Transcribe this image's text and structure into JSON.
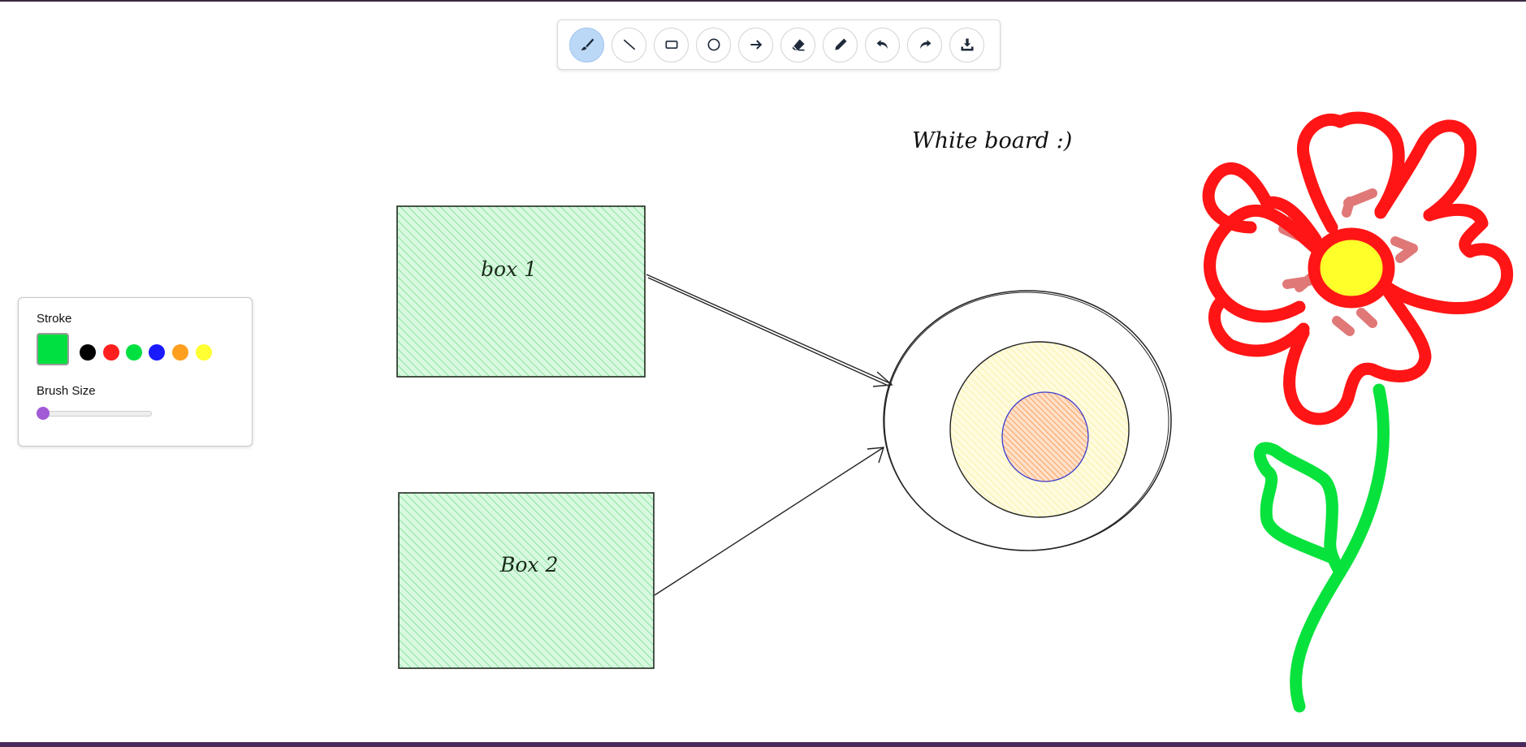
{
  "toolbar": {
    "tools": [
      {
        "icon": "brush-icon",
        "active": true
      },
      {
        "icon": "line-icon",
        "active": false
      },
      {
        "icon": "rectangle-icon",
        "active": false
      },
      {
        "icon": "circle-icon",
        "active": false
      },
      {
        "icon": "arrow-icon",
        "active": false
      },
      {
        "icon": "eraser-icon",
        "active": false
      },
      {
        "icon": "pen-icon",
        "active": false
      },
      {
        "icon": "undo-icon",
        "active": false
      },
      {
        "icon": "redo-icon",
        "active": false
      },
      {
        "icon": "download-icon",
        "active": false
      }
    ]
  },
  "panel": {
    "stroke_label": "Stroke",
    "brush_size_label": "Brush Size",
    "selected_color": "#00e040",
    "colors": [
      "#000000",
      "#ff1f1f",
      "#00e040",
      "#1a1aff",
      "#ff9f1f",
      "#ffff33"
    ],
    "brush_size": 1
  },
  "canvas": {
    "title_text": "White board :)",
    "box1_label": "box 1",
    "box2_label": "Box 2"
  }
}
